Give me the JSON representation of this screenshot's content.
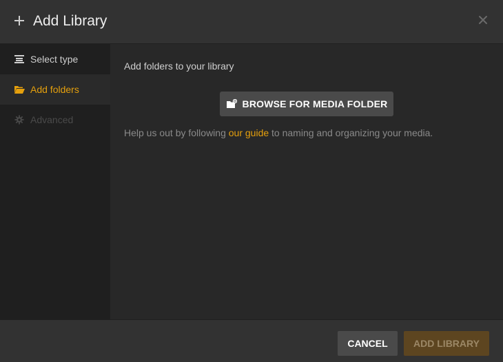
{
  "header": {
    "title": "Add Library",
    "icons": {
      "add": "plus-icon",
      "close": "close-icon"
    }
  },
  "sidebar": {
    "items": [
      {
        "label": "Select type",
        "icon": "list-icon",
        "state": "normal"
      },
      {
        "label": "Add folders",
        "icon": "folder-open-icon",
        "state": "active"
      },
      {
        "label": "Advanced",
        "icon": "gear-icon",
        "state": "disabled"
      }
    ]
  },
  "main": {
    "intro": "Add folders to your library",
    "browse_label": "BROWSE FOR MEDIA FOLDER",
    "help": {
      "before": "Help us out by following ",
      "link": "our guide",
      "after": " to naming and organizing your media."
    }
  },
  "footer": {
    "cancel_label": "CANCEL",
    "add_label": "ADD LIBRARY"
  },
  "colors": {
    "accent": "#e5a00d",
    "background": "#282828",
    "sidebar": "#1f1f1f",
    "button": "#4a4a4a",
    "disabled_primary": "#5d4520"
  }
}
